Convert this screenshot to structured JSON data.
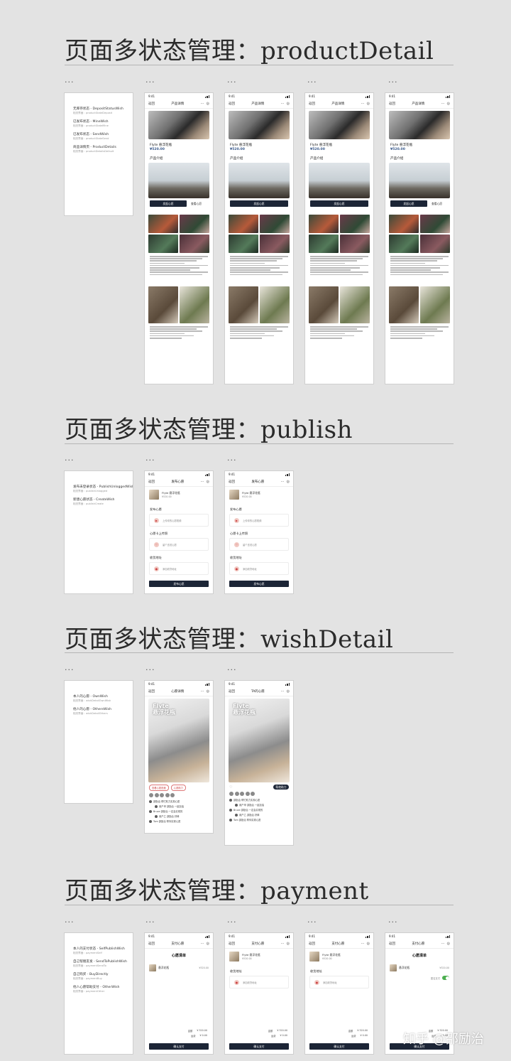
{
  "sections": [
    {
      "title": "页面多状态管理：productDetail"
    },
    {
      "title": "页面多状态管理：publish"
    },
    {
      "title": "页面多状态管理：wishDetail"
    },
    {
      "title": "页面多状态管理：payment"
    }
  ],
  "panel_menu": "...",
  "product": {
    "nav_back": "返回",
    "nav_title": "产品详情",
    "name": "Flyte 悬浮花瓶",
    "price": "¥520.00",
    "intro": "产品介绍",
    "cta": "发起心愿",
    "cta_secondary": "查看心愿"
  },
  "publish": {
    "nav_back": "返回",
    "nav_title": "发布心愿",
    "product_name": "Flyte 悬浮花瓶",
    "product_price": "¥520.00",
    "s1": "发布心愿",
    "c1": "上传你的心愿视频",
    "s2": "心愿卡上传照",
    "c2": "留个言说心愿",
    "s3": "收货地址",
    "c3": "添加收货地址",
    "submit": "发布心愿"
  },
  "wish": {
    "nav_back": "返回",
    "nav_title": "心愿详情",
    "nav_title_alt": "TA的心愿",
    "brand": "Flyte",
    "brand2": "悬浮花瓶",
    "tag1": "查看心愿进度",
    "tag2": "心愿助力",
    "contribute": "帮他助力",
    "comments": [
      "邵励治 帮忙助力实现心愿",
      "用户甲 邵励治 一起加油",
      "Bruce 邵励治 一定会实现的",
      "用户乙 邵励治 好棒",
      "Tom 邵励治 帮你实现心愿"
    ]
  },
  "payment": {
    "nav_back": "返回",
    "nav_title": "支付心愿",
    "list_title": "心愿清单",
    "item_name": "悬浮花瓶",
    "product_name": "Flyte 悬浮花瓶",
    "product_price": "¥520.00",
    "address_head": "收货地址",
    "address": "添加收货地址",
    "switch_label": "匿名支付",
    "sum1_label": "金额",
    "sum1_value": "¥ 520.00",
    "sum2_label": "运费",
    "sum2_value": "¥ 0.00",
    "pay": "确认支付"
  },
  "legend": {
    "product": [
      {
        "name": "无库存状态 - DepositStatusWish",
        "path": "相关界面：productStateDeposit"
      },
      {
        "name": "已发布状态 - MineWish",
        "path": "相关界面：productStateMine"
      },
      {
        "name": "已发布状态 - SendWish",
        "path": "相关界面：productStateSend"
      },
      {
        "name": "商品详情页 - ProductDetails",
        "path": "相关界面：productDetailsDefault"
      }
    ],
    "publish": [
      {
        "name": "发布未登录状态 - PublishUnloggedWish",
        "path": "相关界面：publishUnlogged"
      },
      {
        "name": "新建心愿状态 - CreateWish",
        "path": "相关界面：publishCreate"
      }
    ],
    "wish": [
      {
        "name": "本人的心愿 - OwnWish",
        "path": "相关界面：wishDetailOwnWish"
      },
      {
        "name": "他人的心愿 - OthersWish",
        "path": "相关界面：wishDetailOthers"
      }
    ],
    "payment": [
      {
        "name": "本人的支付状态 - SelfPublishWish",
        "path": "相关界面：paymentSelf"
      },
      {
        "name": "自己帮朋友发 - SendToPublishWish",
        "path": "相关界面：paymentSendTo"
      },
      {
        "name": "自己购买 - BuyDirectly",
        "path": "相关界面：paymentBuy"
      },
      {
        "name": "他人心愿帮助支付 - OtherWish",
        "path": "相关界面：paymentOther"
      }
    ]
  },
  "status_time": "9:41",
  "watermark": "知乎 @邵励治"
}
